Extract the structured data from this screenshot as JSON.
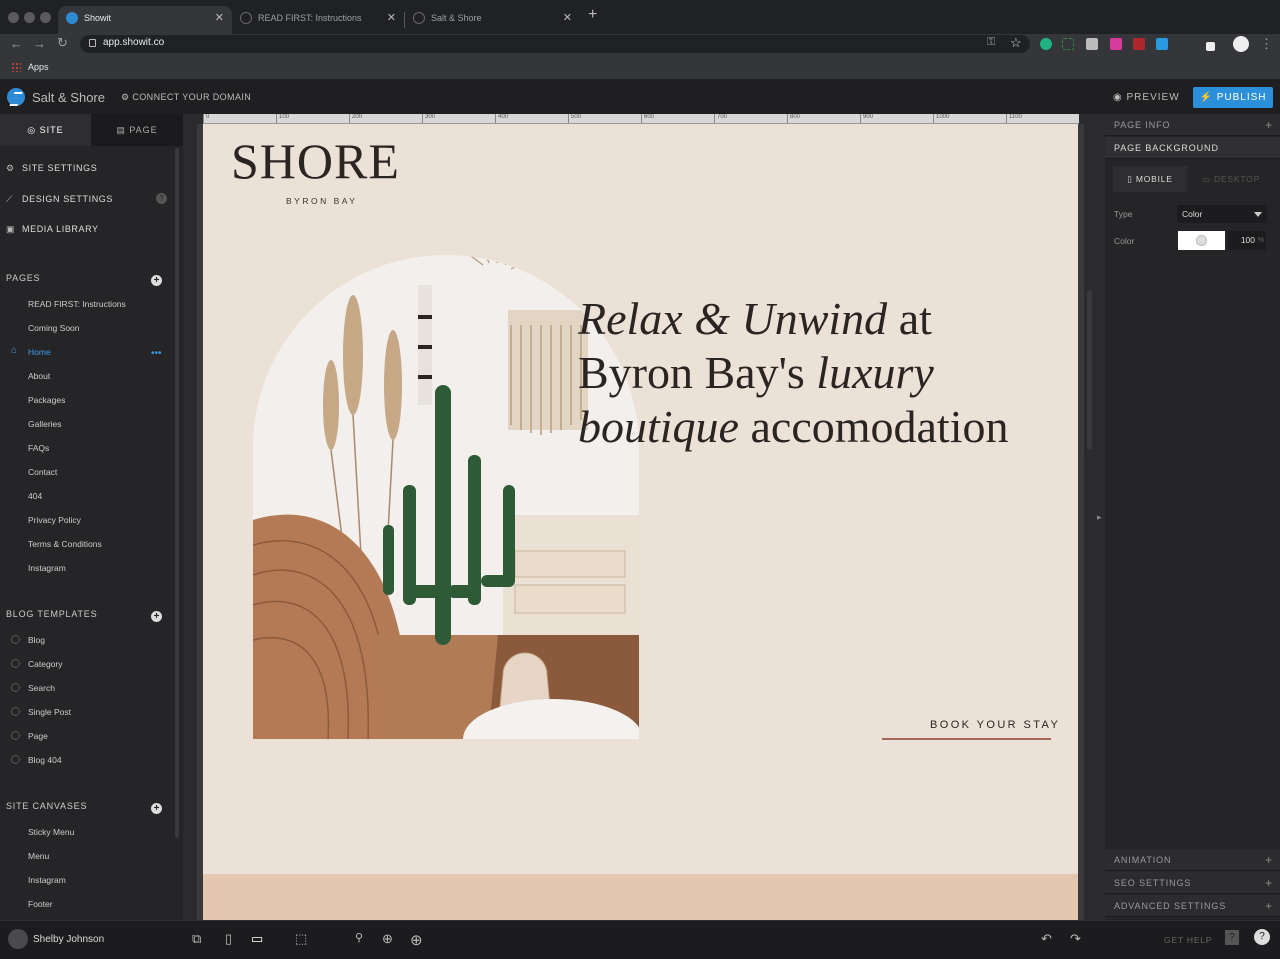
{
  "browser": {
    "tabs": [
      {
        "title": "Showit",
        "active": true
      },
      {
        "title": "READ FIRST: Instructions",
        "active": false
      },
      {
        "title": "Salt & Shore",
        "active": false
      }
    ],
    "url": "app.showit.co",
    "bookmarks": {
      "apps_label": "Apps"
    }
  },
  "header": {
    "site_name": "Salt & Shore",
    "connect_domain": "CONNECT YOUR DOMAIN",
    "preview": "PREVIEW",
    "publish": "PUBLISH",
    "accent": "#2b90d9"
  },
  "sidebar": {
    "tabs": [
      "SITE",
      "PAGE"
    ],
    "main_items": [
      {
        "label": "SITE SETTINGS",
        "icon": "gear-icon"
      },
      {
        "label": "DESIGN SETTINGS",
        "icon": "brush-icon"
      },
      {
        "label": "MEDIA LIBRARY",
        "icon": "image-icon"
      }
    ],
    "help_badge": "?",
    "pages_header": "PAGES",
    "pages": [
      "READ FIRST: Instructions",
      "Coming Soon",
      "Home",
      "About",
      "Packages",
      "Galleries",
      "FAQs",
      "Contact",
      "404",
      "Privacy Policy",
      "Terms & Conditions",
      "Instagram"
    ],
    "current_page": "Home",
    "current_page_menu": "•••",
    "blog_header": "BLOG TEMPLATES",
    "blog_templates": [
      "Blog",
      "Category",
      "Search",
      "Single Post",
      "Page",
      "Blog 404"
    ],
    "canvases_header": "SITE CANVASES",
    "canvases": [
      "Sticky Menu",
      "Menu",
      "Instagram",
      "Footer"
    ]
  },
  "canvas": {
    "ruler_ticks": [
      "0",
      "100",
      "200",
      "300",
      "400",
      "500",
      "600",
      "700",
      "800",
      "900",
      "1000",
      "1100"
    ],
    "logo": "SHORE",
    "logo_sub": "BYRON BAY",
    "headline": {
      "p1": "Relax & Unwind",
      "p2": " at",
      "p3": "Byron Bay's ",
      "p4": "luxury",
      "p5": "boutique",
      "p6": " accomodation"
    },
    "cta": "BOOK YOUR STAY",
    "background": "#ece1d6",
    "cta_underline": "#a6665a"
  },
  "right_panel": {
    "page_info": "PAGE INFO",
    "page_background": "PAGE BACKGROUND",
    "tabs": {
      "mobile": "MOBILE",
      "desktop": "DESKTOP"
    },
    "type_label": "Type",
    "type_value": "Color",
    "color_label": "Color",
    "opacity": "100",
    "opacity_unit": "%",
    "animation": "ANIMATION",
    "seo": "SEO SETTINGS",
    "advanced": "ADVANCED SETTINGS"
  },
  "bottom": {
    "user": "Shelby Johnson",
    "get_help": "GET HELP"
  }
}
